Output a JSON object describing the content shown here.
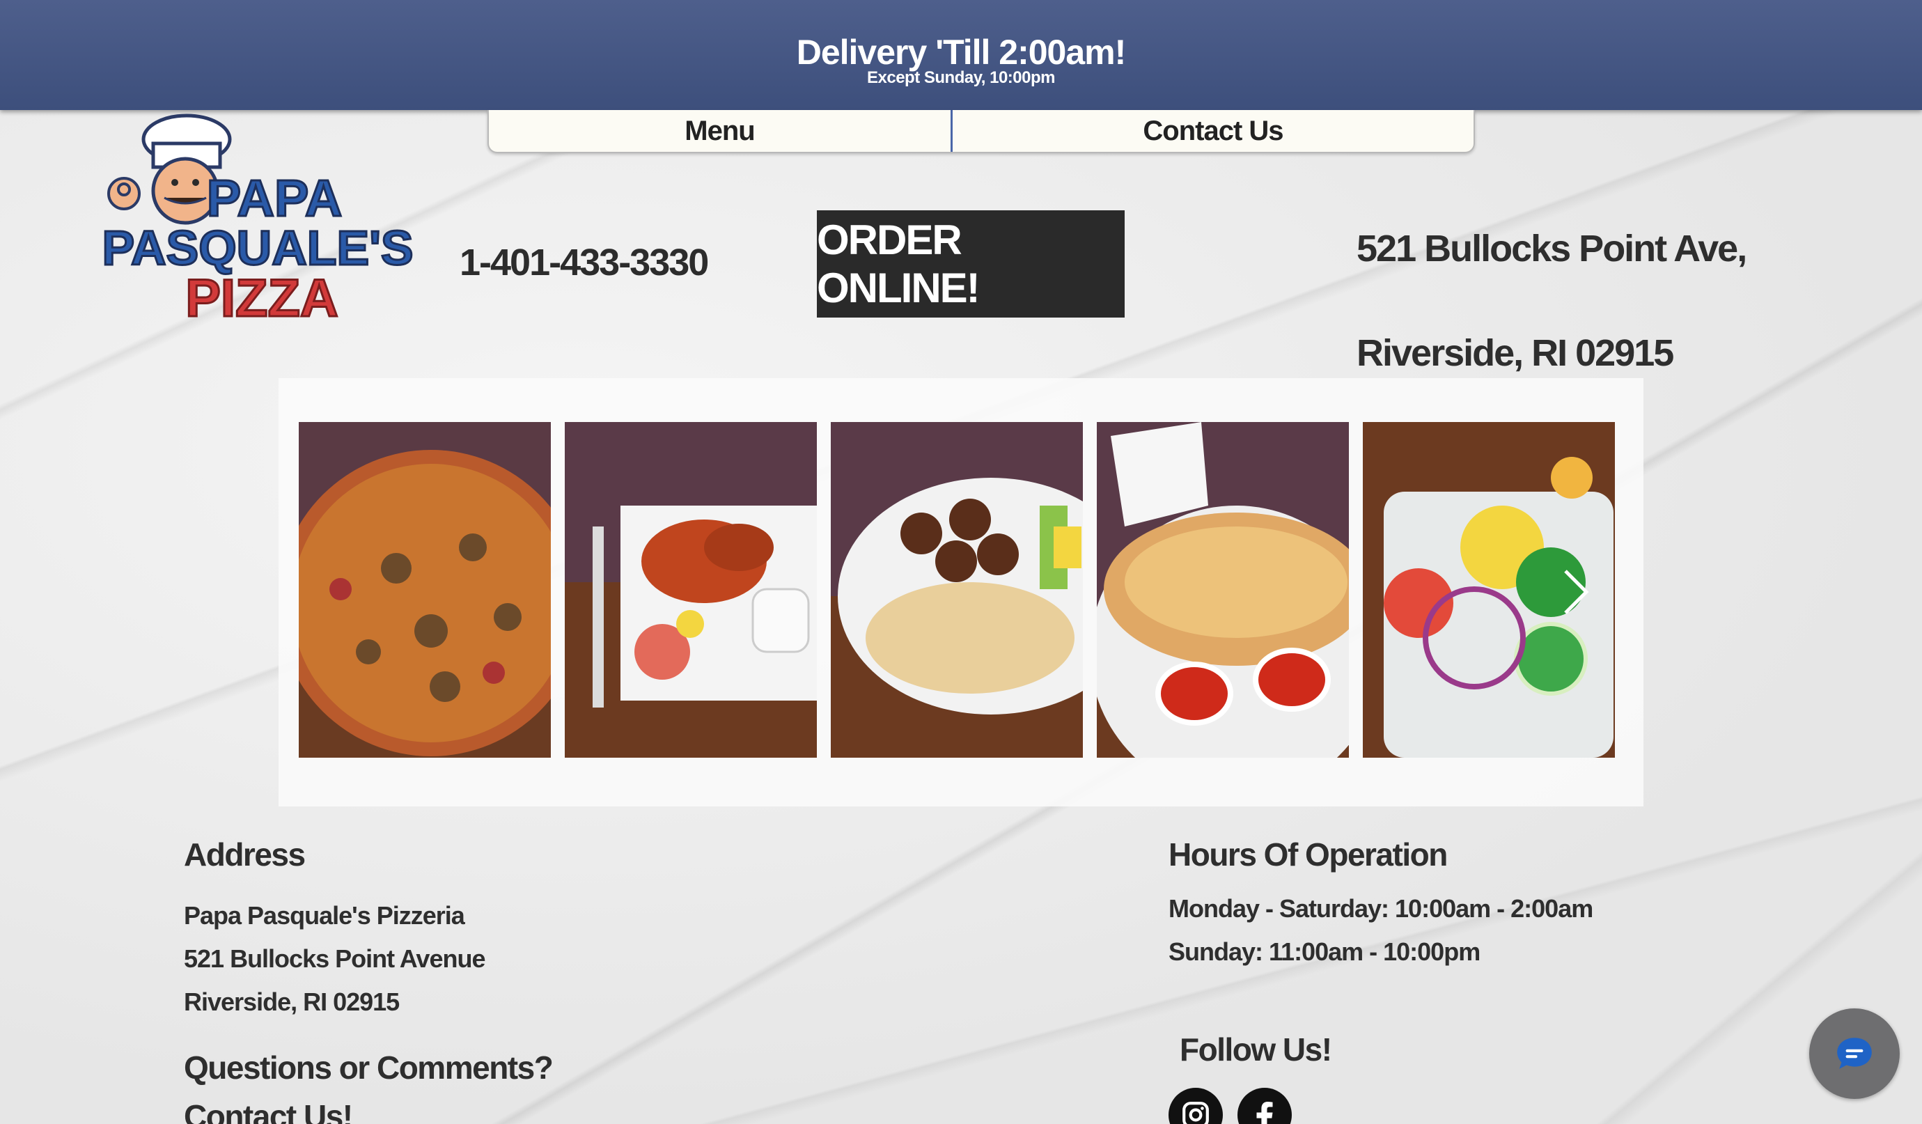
{
  "banner": {
    "headline": "Delivery 'Till 2:00am!",
    "subline": "Except Sunday, 10:00pm"
  },
  "nav": {
    "items": [
      {
        "label": "Menu"
      },
      {
        "label": "Contact Us"
      }
    ]
  },
  "logo": {
    "line1": "PAPA",
    "line2": "PASQUALE'S",
    "line3": "PIZZA"
  },
  "header": {
    "phone": "1-401-433-3330",
    "order_button": "ORDER ONLINE!",
    "address_line1": "521 Bullocks Point Ave,",
    "address_line2": "Riverside, RI 02915"
  },
  "gallery": {
    "photos": [
      {
        "icon": "pizza-photo"
      },
      {
        "icon": "wings-photo"
      },
      {
        "icon": "hummus-falafel-photo"
      },
      {
        "icon": "calzone-photo"
      },
      {
        "icon": "salad-photo"
      }
    ],
    "next_icon": "chevron-right-icon"
  },
  "footer": {
    "address_heading": "Address",
    "address_lines": [
      "Papa Pasquale's Pizzeria",
      "521 Bullocks Point Avenue",
      "Riverside, RI 02915"
    ],
    "questions_heading": "Questions or Comments?",
    "contact_heading": "Contact Us!",
    "hours_heading": "Hours Of Operation",
    "hours_lines": [
      "Monday - Saturday: 10:00am - 2:00am",
      "Sunday: 11:00am - 10:00pm"
    ],
    "follow_heading": "Follow Us!",
    "social": [
      "instagram-icon",
      "facebook-icon"
    ]
  },
  "chat": {
    "icon": "chat-bubble-icon"
  },
  "colors": {
    "banner": "#46577f",
    "order_button": "#2a2a2a",
    "nav_divider": "#4a66a8",
    "logo_blue": "#2a5aa8",
    "logo_red": "#d23a3a"
  }
}
